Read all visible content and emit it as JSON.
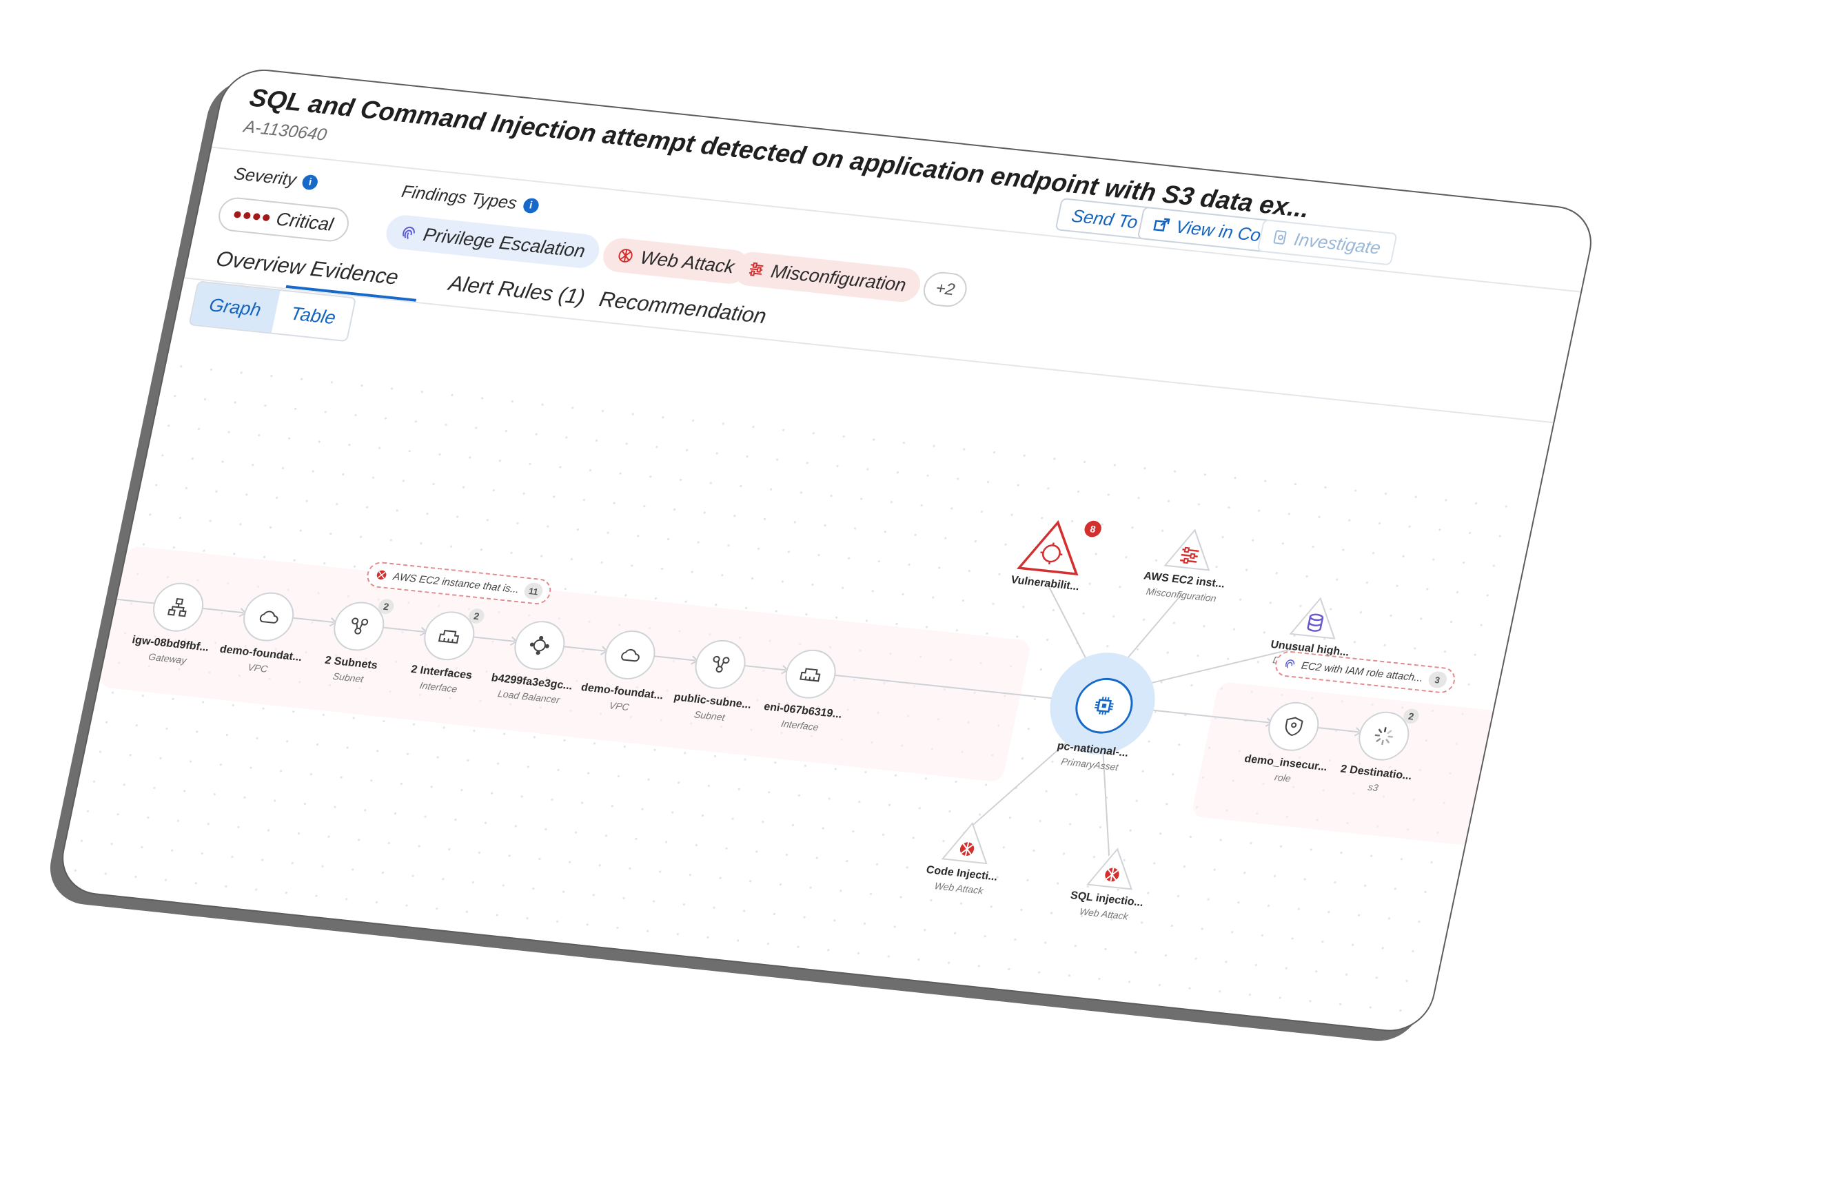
{
  "header": {
    "title": "SQL and Command Injection attempt detected on application endpoint with S3 data ex...",
    "alert_id": "A-1130640",
    "send_to": "Send To",
    "view_console": "View in Console",
    "investigate": "Investigate"
  },
  "severity": {
    "label": "Severity",
    "info": "i",
    "value": "Critical"
  },
  "findings": {
    "label": "Findings Types",
    "info": "i",
    "chips": [
      "Privilege Escalation",
      "Web Attack",
      "Misconfiguration"
    ],
    "more": "+2"
  },
  "tabs": [
    "Overview",
    "Evidence",
    "Alert Rules (1)",
    "Recommendation"
  ],
  "view_toggle": {
    "graph": "Graph",
    "table": "Table"
  },
  "graph": {
    "chain": [
      {
        "name": "igw-08bd9fbf...",
        "type": "Gateway",
        "icon": "gateway-icon"
      },
      {
        "name": "demo-foundat...",
        "type": "VPC",
        "icon": "vpc-cloud-icon"
      },
      {
        "name": "2 Subnets",
        "type": "Subnet",
        "icon": "subnet-icon",
        "count": "2"
      },
      {
        "name": "2 Interfaces",
        "type": "Interface",
        "icon": "interface-icon",
        "count": "2"
      },
      {
        "name": "b4299fa3e3gc...",
        "type": "Load Balancer",
        "icon": "load-balancer-icon"
      },
      {
        "name": "demo-foundat...",
        "type": "VPC",
        "icon": "vpc-cloud-icon"
      },
      {
        "name": "public-subne...",
        "type": "Subnet",
        "icon": "subnet-icon"
      },
      {
        "name": "eni-067b6319...",
        "type": "Interface",
        "icon": "interface-icon"
      }
    ],
    "chain_callout": {
      "text": "AWS EC2 instance that is...",
      "count": "11"
    },
    "primary": {
      "name": "pc-national-...",
      "type": "PrimaryAsset",
      "icon": "cpu-chip-icon"
    },
    "findings": [
      {
        "name": "Vulnerabilit...",
        "type": "",
        "badge": "8",
        "icon": "vulnerability-icon"
      },
      {
        "name": "AWS EC2 inst...",
        "type": "Misconfiguration",
        "icon": "sliders-icon"
      },
      {
        "name": "Unusual high...",
        "type": "Data Exfiltration",
        "icon": "database-icon"
      },
      {
        "name": "Code Injecti...",
        "type": "Web Attack",
        "icon": "web-attack-icon"
      },
      {
        "name": "SQL injectio...",
        "type": "Web Attack",
        "icon": "web-attack-icon"
      }
    ],
    "right_chain": [
      {
        "name": "demo_insecur...",
        "type": "role",
        "icon": "shield-icon"
      },
      {
        "name": "2 Destinatio...",
        "type": "s3",
        "icon": "spinner-icon",
        "count": "2"
      }
    ],
    "right_callout": {
      "text": "EC2 with IAM role attach...",
      "count": "3"
    }
  },
  "colors": {
    "accent": "#1669c9",
    "critical": "#a11a1a",
    "finding_red": "#d32f2f"
  }
}
